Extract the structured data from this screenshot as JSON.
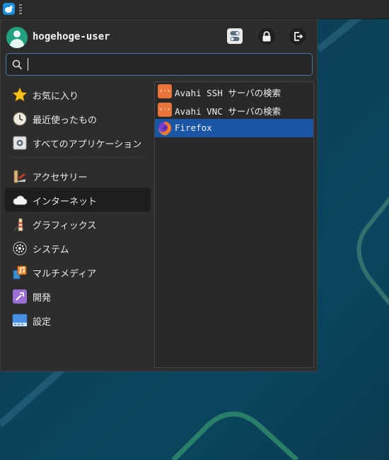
{
  "user": {
    "name": "hogehoge-user"
  },
  "header_buttons": [
    {
      "name": "settings-button",
      "icon": "settings-icon"
    },
    {
      "name": "lock-button",
      "icon": "lock-icon"
    },
    {
      "name": "logout-button",
      "icon": "logout-icon"
    }
  ],
  "search": {
    "value": "",
    "placeholder": ""
  },
  "categories": [
    {
      "label": "お気に入り",
      "icon": "star-icon"
    },
    {
      "label": "最近使ったもの",
      "icon": "recent-icon"
    },
    {
      "label": "すべてのアプリケーション",
      "icon": "all-apps-icon"
    },
    {
      "label": "アクセサリー",
      "icon": "accessories-icon"
    },
    {
      "label": "インターネット",
      "icon": "internet-cloud-icon",
      "active": true
    },
    {
      "label": "グラフィックス",
      "icon": "graphics-icon"
    },
    {
      "label": "システム",
      "icon": "system-gear-icon"
    },
    {
      "label": "マルチメディア",
      "icon": "multimedia-icon"
    },
    {
      "label": "開発",
      "icon": "development-icon"
    },
    {
      "label": "設定",
      "icon": "settings-panel-icon"
    }
  ],
  "apps": [
    {
      "label": "Avahi SSH サーバの検索",
      "icon": "network-browse-icon"
    },
    {
      "label": "Avahi VNC サーバの検索",
      "icon": "network-browse-icon"
    },
    {
      "label": "Firefox",
      "icon": "firefox-icon",
      "selected": true
    }
  ],
  "colors": {
    "selection": "#1a56a3",
    "search_border": "#4d77a8",
    "avatar": "#23a07f"
  }
}
